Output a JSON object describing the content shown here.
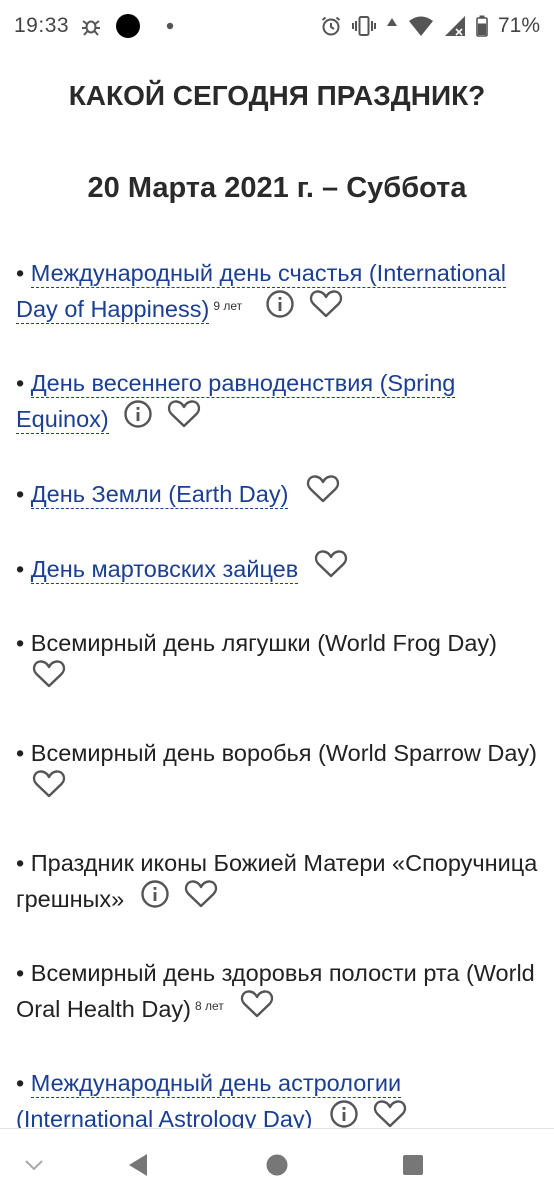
{
  "status_bar": {
    "time": "19:33",
    "battery_percent": "71%",
    "icons": [
      "bug-notification-icon",
      "dark-circle-icon",
      "dot-icon",
      "alarm-icon",
      "vibrate-icon",
      "signal-up-icon",
      "wifi-icon",
      "cell-signal-icon",
      "battery-icon"
    ]
  },
  "page": {
    "title": "КАКОЙ СЕГОДНЯ ПРАЗДНИК?",
    "date_heading": "20 Марта 2021 г. – Суббота"
  },
  "holidays": [
    {
      "bullet": "• ",
      "text": "Международный день счастья (International Day of Happiness)",
      "link": true,
      "years": "9 лет",
      "info": true
    },
    {
      "bullet": "• ",
      "text": "День весеннего равноденствия (Spring Equinox)",
      "link": true,
      "years": "",
      "info": true
    },
    {
      "bullet": "• ",
      "text": "День Земли (Earth Day)",
      "link": true,
      "years": "",
      "info": false
    },
    {
      "bullet": "• ",
      "text": "День мартовских зайцев",
      "link": true,
      "years": "",
      "info": false
    },
    {
      "bullet": "• ",
      "text": "Всемирный день лягушки (World Frog Day)",
      "link": false,
      "years": "",
      "info": false
    },
    {
      "bullet": "• ",
      "text": "Всемирный день воробья (World Sparrow Day)",
      "link": false,
      "years": "",
      "info": false
    },
    {
      "bullet": "• ",
      "text": "Праздник иконы Божией Матери «Споручница грешных»",
      "link": false,
      "years": "",
      "info": true
    },
    {
      "bullet": "• ",
      "text": "Всемирный день здоровья полости рта (World Oral Health Day)",
      "link": false,
      "years": "8 лет",
      "info": false
    },
    {
      "bullet": "• ",
      "text": "Международный день астрологии (International Astrology Day)",
      "link": true,
      "years": "",
      "info": true
    }
  ],
  "colors": {
    "link": "#1b3f93",
    "text": "#222222",
    "icon": "#555555"
  },
  "nav_bar": {
    "icons": [
      "chevron-down-icon",
      "back-icon",
      "home-icon",
      "recents-icon"
    ]
  }
}
